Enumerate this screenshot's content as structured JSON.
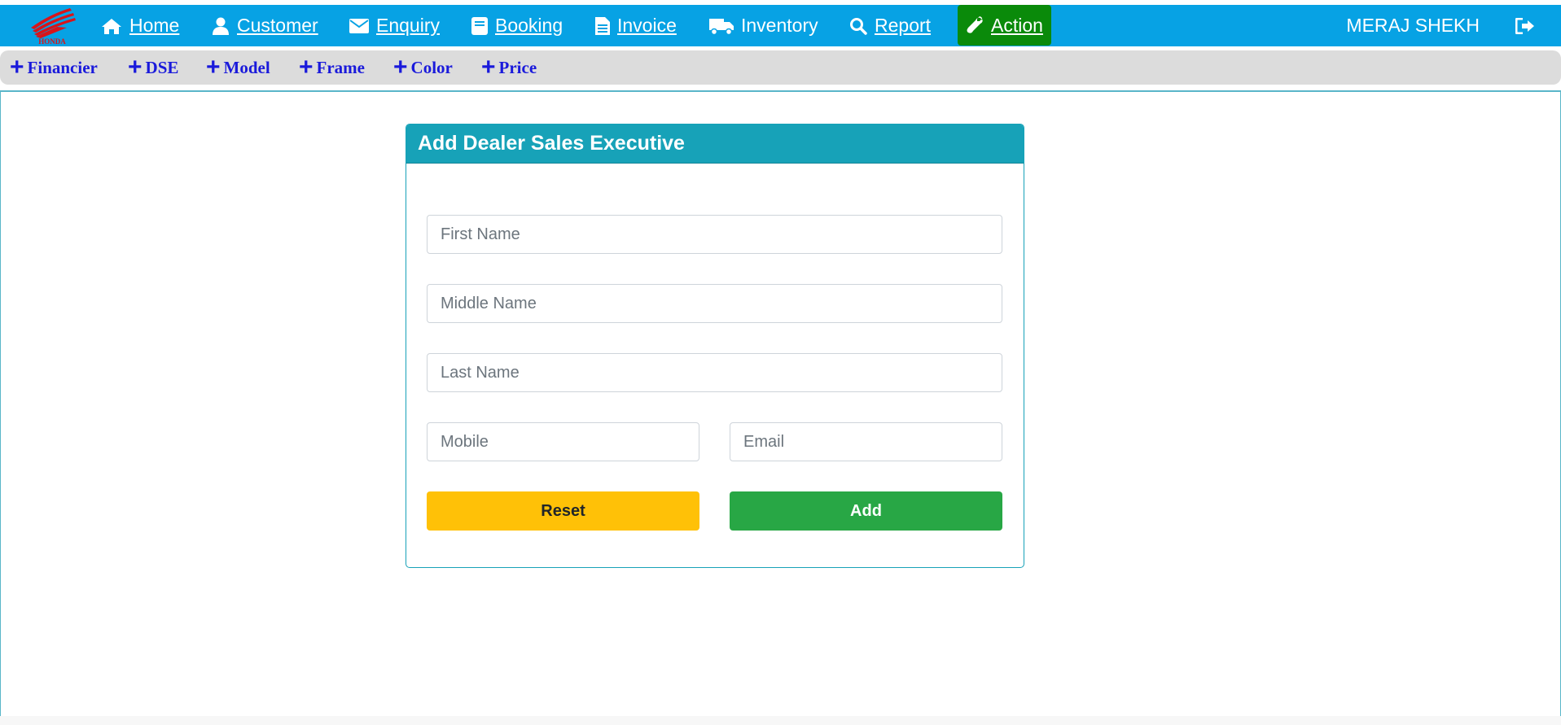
{
  "brand": {
    "logo_text": "HONDA"
  },
  "nav": {
    "items": [
      {
        "label": "Home",
        "icon": "home-icon"
      },
      {
        "label": "Customer",
        "icon": "user-icon"
      },
      {
        "label": "Enquiry",
        "icon": "envelope-icon"
      },
      {
        "label": "Booking",
        "icon": "book-icon"
      },
      {
        "label": "Invoice",
        "icon": "file-icon"
      },
      {
        "label": "Inventory",
        "icon": "truck-icon"
      },
      {
        "label": "Report",
        "icon": "search-icon"
      },
      {
        "label": "Action",
        "icon": "wrench-icon",
        "active": true
      }
    ],
    "user_name": "MERAJ SHEKH",
    "logout_icon": "sign-out-icon"
  },
  "subnav": {
    "items": [
      {
        "label": "Financier"
      },
      {
        "label": "DSE"
      },
      {
        "label": "Model"
      },
      {
        "label": "Frame"
      },
      {
        "label": "Color"
      },
      {
        "label": "Price"
      }
    ]
  },
  "form": {
    "title": "Add Dealer Sales Executive",
    "first_name": {
      "placeholder": "First Name",
      "value": ""
    },
    "middle_name": {
      "placeholder": "Middle Name",
      "value": ""
    },
    "last_name": {
      "placeholder": "Last Name",
      "value": ""
    },
    "mobile": {
      "placeholder": "Mobile",
      "value": ""
    },
    "email": {
      "placeholder": "Email",
      "value": ""
    },
    "reset_label": "Reset",
    "add_label": "Add"
  },
  "colors": {
    "topbar": "#07a2e4",
    "active_nav": "#0a8a0a",
    "card_header": "#17a2b8",
    "reset": "#ffc107",
    "add": "#28a745",
    "subnav_text": "#1a1adb"
  }
}
